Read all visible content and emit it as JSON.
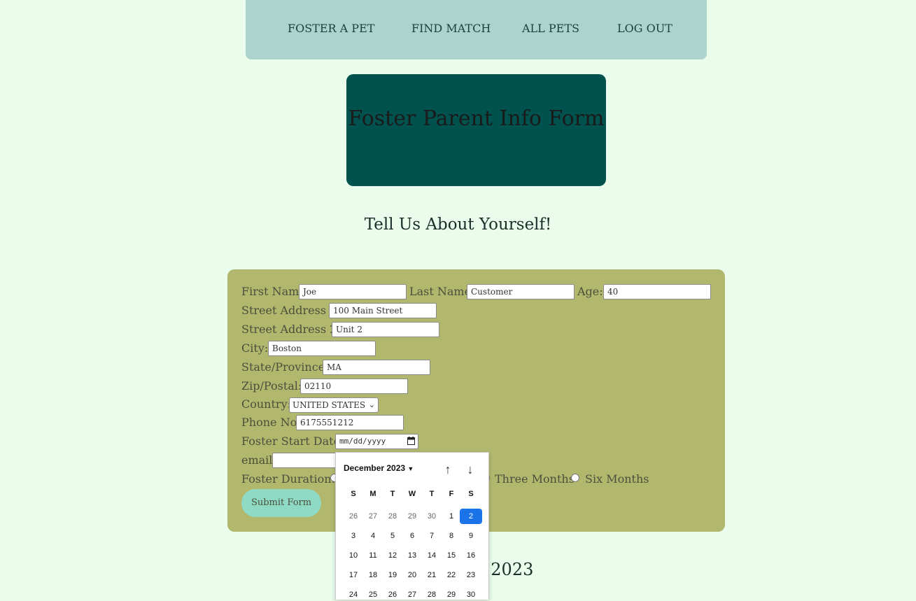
{
  "nav": {
    "items": [
      {
        "label": "FOSTER A PET"
      },
      {
        "label": "FIND MATCH"
      },
      {
        "label": "ALL PETS"
      },
      {
        "label": "LOG OUT"
      }
    ]
  },
  "banner": {
    "title": "Foster Parent Info Form"
  },
  "subtitle": "Tell Us About Yourself!",
  "form": {
    "first_name_label": "First Name:",
    "first_name_value": "Joe",
    "last_name_label": "Last Name:",
    "last_name_value": "Customer",
    "age_label": "Age:",
    "age_value": "40",
    "street1_label": "Street Address 1:",
    "street1_value": "100 Main Street",
    "street2_label": "Street Address 2:",
    "street2_value": "Unit 2",
    "city_label": "City:",
    "city_value": "Boston",
    "state_label": "State/Province:",
    "state_value": "MA",
    "zip_label": "Zip/Postal:",
    "zip_value": "02110",
    "country_label": "Country:",
    "country_value": "UNITED STATES",
    "phone_label": "Phone No:",
    "phone_value": "6175551212",
    "start_date_label": "Foster Start Date:",
    "start_date_placeholder": "mm/dd/yyyy",
    "email_label": "email:",
    "email_value": "",
    "duration_label": "Foster Duration:",
    "duration_options": [
      "Three Months",
      "Six Months"
    ],
    "submit_label": "Submit Form"
  },
  "footer_partial": "t 2023",
  "date_picker": {
    "month_label": "December 2023",
    "weekdays": [
      "S",
      "M",
      "T",
      "W",
      "T",
      "F",
      "S"
    ],
    "weeks": [
      [
        "26",
        "27",
        "28",
        "29",
        "30",
        "1",
        "2"
      ],
      [
        "3",
        "4",
        "5",
        "6",
        "7",
        "8",
        "9"
      ],
      [
        "10",
        "11",
        "12",
        "13",
        "14",
        "15",
        "16"
      ],
      [
        "17",
        "18",
        "19",
        "20",
        "21",
        "22",
        "23"
      ],
      [
        "24",
        "25",
        "26",
        "27",
        "28",
        "29",
        "30"
      ]
    ],
    "selected_day": "2",
    "accent_color": "#1a73e8"
  },
  "colors": {
    "page_bg": "#eafdec",
    "nav_bg": "#acd3cc",
    "banner_bg": "#00524f",
    "form_bg": "#b1b86e",
    "submit_bg": "#8fdac5"
  }
}
